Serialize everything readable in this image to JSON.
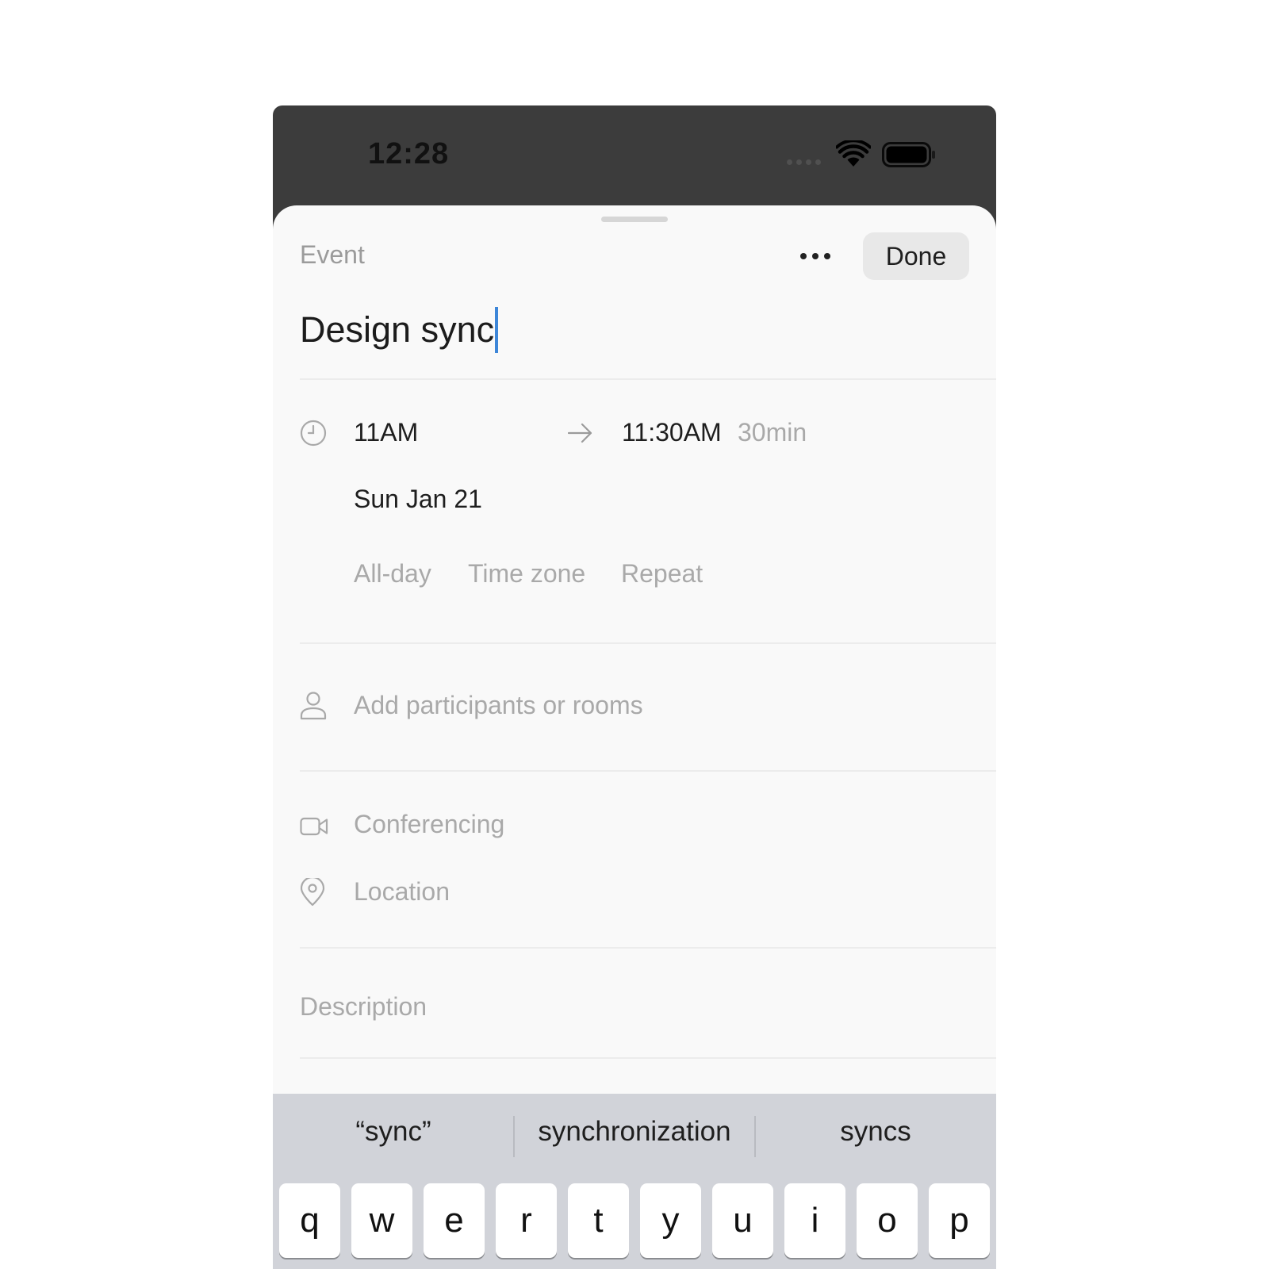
{
  "status_bar": {
    "time": "12:28"
  },
  "sheet": {
    "kind_label": "Event",
    "done_label": "Done",
    "title_value": "Design sync"
  },
  "time_row": {
    "start": "11AM",
    "end": "11:30AM",
    "duration": "30min",
    "date": "Sun Jan 21",
    "options": [
      "All-day",
      "Time zone",
      "Repeat"
    ]
  },
  "participants": {
    "placeholder": "Add participants or rooms"
  },
  "conferencing": {
    "label": "Conferencing"
  },
  "location": {
    "placeholder": "Location"
  },
  "description": {
    "placeholder": "Description"
  },
  "keyboard": {
    "suggestions": [
      "“sync”",
      "synchronization",
      "syncs"
    ],
    "top_row": [
      "q",
      "w",
      "e",
      "r",
      "t",
      "y",
      "u",
      "i",
      "o",
      "p"
    ]
  },
  "colors": {
    "caret": "#3d86d8",
    "status_bar_bg": "#3c3c3c",
    "sheet_bg": "#f9f9f9",
    "keyboard_bg": "#d1d3d9"
  },
  "icons": [
    "wifi-icon",
    "battery-icon",
    "more-icon",
    "clock-icon",
    "arrow-right-icon",
    "person-icon",
    "video-camera-icon",
    "location-pin-icon"
  ]
}
